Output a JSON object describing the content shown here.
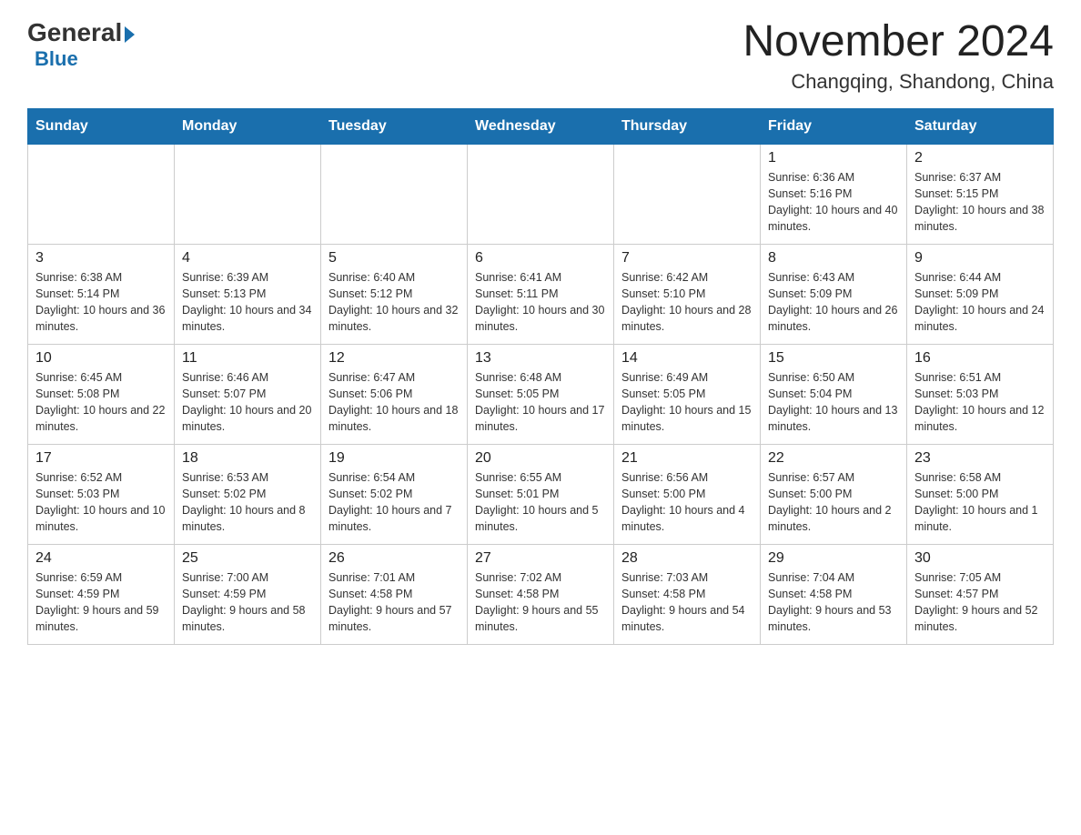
{
  "header": {
    "logo_general": "General",
    "logo_blue": "Blue",
    "title": "November 2024",
    "subtitle": "Changqing, Shandong, China"
  },
  "days_of_week": [
    "Sunday",
    "Monday",
    "Tuesday",
    "Wednesday",
    "Thursday",
    "Friday",
    "Saturday"
  ],
  "weeks": [
    [
      {
        "day": "",
        "sunrise": "",
        "sunset": "",
        "daylight": ""
      },
      {
        "day": "",
        "sunrise": "",
        "sunset": "",
        "daylight": ""
      },
      {
        "day": "",
        "sunrise": "",
        "sunset": "",
        "daylight": ""
      },
      {
        "day": "",
        "sunrise": "",
        "sunset": "",
        "daylight": ""
      },
      {
        "day": "",
        "sunrise": "",
        "sunset": "",
        "daylight": ""
      },
      {
        "day": "1",
        "sunrise": "Sunrise: 6:36 AM",
        "sunset": "Sunset: 5:16 PM",
        "daylight": "Daylight: 10 hours and 40 minutes."
      },
      {
        "day": "2",
        "sunrise": "Sunrise: 6:37 AM",
        "sunset": "Sunset: 5:15 PM",
        "daylight": "Daylight: 10 hours and 38 minutes."
      }
    ],
    [
      {
        "day": "3",
        "sunrise": "Sunrise: 6:38 AM",
        "sunset": "Sunset: 5:14 PM",
        "daylight": "Daylight: 10 hours and 36 minutes."
      },
      {
        "day": "4",
        "sunrise": "Sunrise: 6:39 AM",
        "sunset": "Sunset: 5:13 PM",
        "daylight": "Daylight: 10 hours and 34 minutes."
      },
      {
        "day": "5",
        "sunrise": "Sunrise: 6:40 AM",
        "sunset": "Sunset: 5:12 PM",
        "daylight": "Daylight: 10 hours and 32 minutes."
      },
      {
        "day": "6",
        "sunrise": "Sunrise: 6:41 AM",
        "sunset": "Sunset: 5:11 PM",
        "daylight": "Daylight: 10 hours and 30 minutes."
      },
      {
        "day": "7",
        "sunrise": "Sunrise: 6:42 AM",
        "sunset": "Sunset: 5:10 PM",
        "daylight": "Daylight: 10 hours and 28 minutes."
      },
      {
        "day": "8",
        "sunrise": "Sunrise: 6:43 AM",
        "sunset": "Sunset: 5:09 PM",
        "daylight": "Daylight: 10 hours and 26 minutes."
      },
      {
        "day": "9",
        "sunrise": "Sunrise: 6:44 AM",
        "sunset": "Sunset: 5:09 PM",
        "daylight": "Daylight: 10 hours and 24 minutes."
      }
    ],
    [
      {
        "day": "10",
        "sunrise": "Sunrise: 6:45 AM",
        "sunset": "Sunset: 5:08 PM",
        "daylight": "Daylight: 10 hours and 22 minutes."
      },
      {
        "day": "11",
        "sunrise": "Sunrise: 6:46 AM",
        "sunset": "Sunset: 5:07 PM",
        "daylight": "Daylight: 10 hours and 20 minutes."
      },
      {
        "day": "12",
        "sunrise": "Sunrise: 6:47 AM",
        "sunset": "Sunset: 5:06 PM",
        "daylight": "Daylight: 10 hours and 18 minutes."
      },
      {
        "day": "13",
        "sunrise": "Sunrise: 6:48 AM",
        "sunset": "Sunset: 5:05 PM",
        "daylight": "Daylight: 10 hours and 17 minutes."
      },
      {
        "day": "14",
        "sunrise": "Sunrise: 6:49 AM",
        "sunset": "Sunset: 5:05 PM",
        "daylight": "Daylight: 10 hours and 15 minutes."
      },
      {
        "day": "15",
        "sunrise": "Sunrise: 6:50 AM",
        "sunset": "Sunset: 5:04 PM",
        "daylight": "Daylight: 10 hours and 13 minutes."
      },
      {
        "day": "16",
        "sunrise": "Sunrise: 6:51 AM",
        "sunset": "Sunset: 5:03 PM",
        "daylight": "Daylight: 10 hours and 12 minutes."
      }
    ],
    [
      {
        "day": "17",
        "sunrise": "Sunrise: 6:52 AM",
        "sunset": "Sunset: 5:03 PM",
        "daylight": "Daylight: 10 hours and 10 minutes."
      },
      {
        "day": "18",
        "sunrise": "Sunrise: 6:53 AM",
        "sunset": "Sunset: 5:02 PM",
        "daylight": "Daylight: 10 hours and 8 minutes."
      },
      {
        "day": "19",
        "sunrise": "Sunrise: 6:54 AM",
        "sunset": "Sunset: 5:02 PM",
        "daylight": "Daylight: 10 hours and 7 minutes."
      },
      {
        "day": "20",
        "sunrise": "Sunrise: 6:55 AM",
        "sunset": "Sunset: 5:01 PM",
        "daylight": "Daylight: 10 hours and 5 minutes."
      },
      {
        "day": "21",
        "sunrise": "Sunrise: 6:56 AM",
        "sunset": "Sunset: 5:00 PM",
        "daylight": "Daylight: 10 hours and 4 minutes."
      },
      {
        "day": "22",
        "sunrise": "Sunrise: 6:57 AM",
        "sunset": "Sunset: 5:00 PM",
        "daylight": "Daylight: 10 hours and 2 minutes."
      },
      {
        "day": "23",
        "sunrise": "Sunrise: 6:58 AM",
        "sunset": "Sunset: 5:00 PM",
        "daylight": "Daylight: 10 hours and 1 minute."
      }
    ],
    [
      {
        "day": "24",
        "sunrise": "Sunrise: 6:59 AM",
        "sunset": "Sunset: 4:59 PM",
        "daylight": "Daylight: 9 hours and 59 minutes."
      },
      {
        "day": "25",
        "sunrise": "Sunrise: 7:00 AM",
        "sunset": "Sunset: 4:59 PM",
        "daylight": "Daylight: 9 hours and 58 minutes."
      },
      {
        "day": "26",
        "sunrise": "Sunrise: 7:01 AM",
        "sunset": "Sunset: 4:58 PM",
        "daylight": "Daylight: 9 hours and 57 minutes."
      },
      {
        "day": "27",
        "sunrise": "Sunrise: 7:02 AM",
        "sunset": "Sunset: 4:58 PM",
        "daylight": "Daylight: 9 hours and 55 minutes."
      },
      {
        "day": "28",
        "sunrise": "Sunrise: 7:03 AM",
        "sunset": "Sunset: 4:58 PM",
        "daylight": "Daylight: 9 hours and 54 minutes."
      },
      {
        "day": "29",
        "sunrise": "Sunrise: 7:04 AM",
        "sunset": "Sunset: 4:58 PM",
        "daylight": "Daylight: 9 hours and 53 minutes."
      },
      {
        "day": "30",
        "sunrise": "Sunrise: 7:05 AM",
        "sunset": "Sunset: 4:57 PM",
        "daylight": "Daylight: 9 hours and 52 minutes."
      }
    ]
  ]
}
